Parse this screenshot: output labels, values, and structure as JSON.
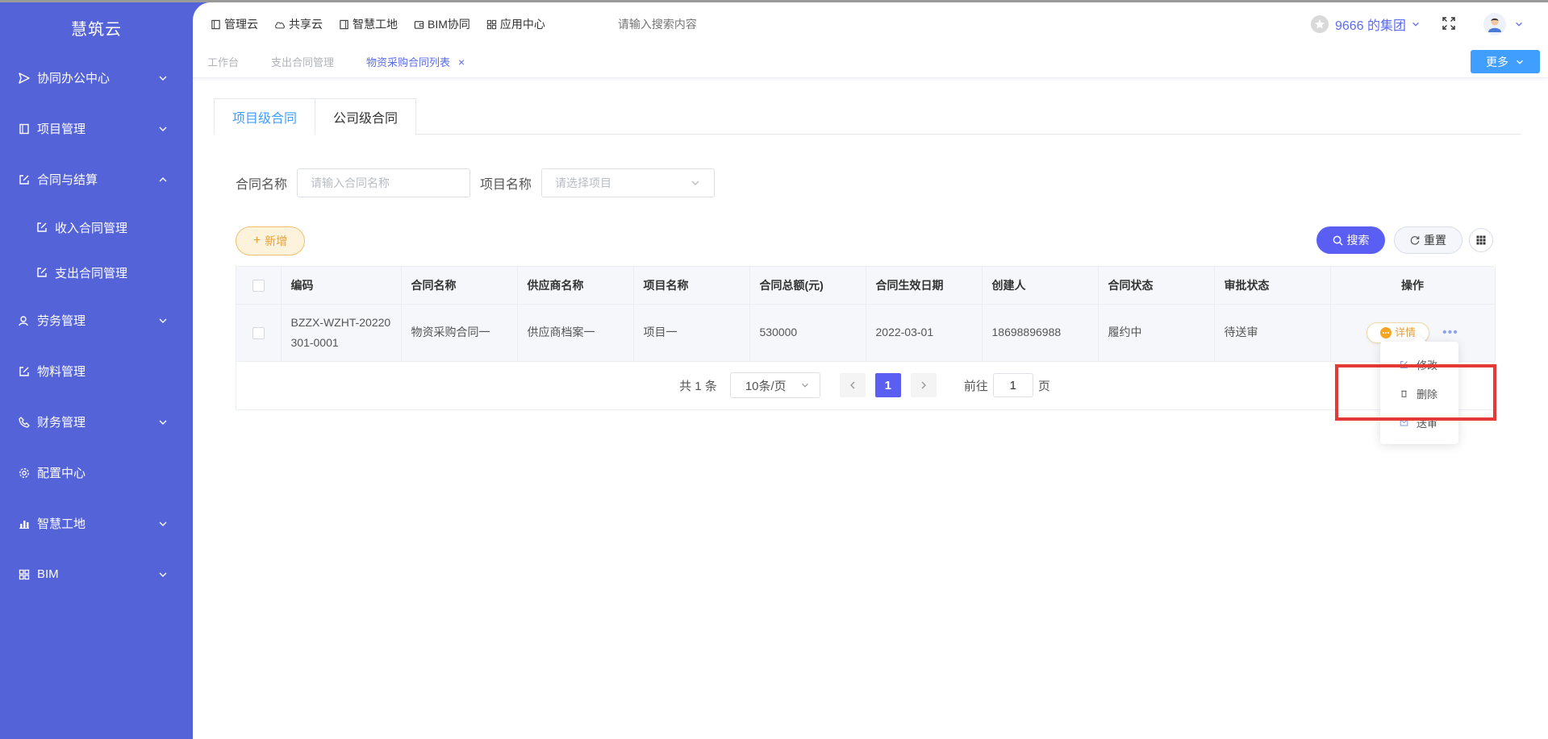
{
  "brand": "慧筑云",
  "sidebar": {
    "items": [
      {
        "label": "协同办公中心",
        "icon": "send-icon",
        "expanded": false,
        "has_children": true
      },
      {
        "label": "项目管理",
        "icon": "book-icon",
        "expanded": false,
        "has_children": true
      },
      {
        "label": "合同与结算",
        "icon": "edit-icon",
        "expanded": true,
        "has_children": true
      },
      {
        "label": "收入合同管理",
        "icon": "edit-icon",
        "sub": true
      },
      {
        "label": "支出合同管理",
        "icon": "edit-icon",
        "sub": true
      },
      {
        "label": "劳务管理",
        "icon": "user-icon",
        "expanded": false,
        "has_children": true
      },
      {
        "label": "物料管理",
        "icon": "edit-icon",
        "has_children": false
      },
      {
        "label": "财务管理",
        "icon": "phone-icon",
        "expanded": false,
        "has_children": true
      },
      {
        "label": "配置中心",
        "icon": "gear-icon",
        "has_children": false
      },
      {
        "label": "智慧工地",
        "icon": "bar-chart-icon",
        "expanded": false,
        "has_children": true
      },
      {
        "label": "BIM",
        "icon": "grid-icon",
        "expanded": false,
        "has_children": true
      }
    ]
  },
  "topnav": {
    "items": [
      {
        "label": "管理云",
        "icon": "book-icon"
      },
      {
        "label": "共享云",
        "icon": "cloud-icon"
      },
      {
        "label": "智慧工地",
        "icon": "document-icon"
      },
      {
        "label": "BIM协同",
        "icon": "wallet-icon"
      },
      {
        "label": "应用中心",
        "icon": "grid-icon"
      }
    ],
    "search_placeholder": "请输入搜索内容",
    "org": "9666 的集团"
  },
  "tabs": {
    "items": [
      {
        "label": "工作台",
        "active": false
      },
      {
        "label": "支出合同管理",
        "active": false
      },
      {
        "label": "物资采购合同列表",
        "active": true,
        "closable": true
      }
    ],
    "close_symbol": "×",
    "more_label": "更多"
  },
  "content_tabs": [
    {
      "label": "项目级合同",
      "active": true
    },
    {
      "label": "公司级合同",
      "active": false
    }
  ],
  "filters": {
    "contract_name_label": "合同名称",
    "contract_name_placeholder": "请输入合同名称",
    "project_name_label": "项目名称",
    "project_name_placeholder": "请选择项目"
  },
  "actions": {
    "add_label": "新增",
    "add_prefix": "+",
    "search_label": "搜索",
    "reset_label": "重置"
  },
  "table": {
    "columns": [
      "编码",
      "合同名称",
      "供应商名称",
      "项目名称",
      "合同总额(元)",
      "合同生效日期",
      "创建人",
      "合同状态",
      "审批状态",
      "操作"
    ],
    "rows": [
      {
        "code": "BZZX-WZHT-20220301-0001",
        "name": "物资采购合同一",
        "supplier": "供应商档案一",
        "project": "项目一",
        "amount": "530000",
        "date": "2022-03-01",
        "creator": "18698896988",
        "status": "履约中",
        "approval": "待送审",
        "detail_label": "详情",
        "more_symbol": "•••"
      }
    ]
  },
  "pagination": {
    "total": "共 1 条",
    "page_size": "10条/页",
    "current": "1",
    "goto_prefix": "前往",
    "goto_value": "1",
    "goto_suffix": "页"
  },
  "dropdown": {
    "items": [
      {
        "label": "修改",
        "icon": "edit-icon"
      },
      {
        "label": "删除",
        "icon": "trash-icon"
      },
      {
        "label": "送审",
        "icon": "send-review-icon"
      }
    ]
  },
  "colors": {
    "sidebar": "#5563d9",
    "primary": "#5b5ef2",
    "accent_blue": "#409eff",
    "warning": "#e6a23c",
    "highlight": "#e53935"
  }
}
